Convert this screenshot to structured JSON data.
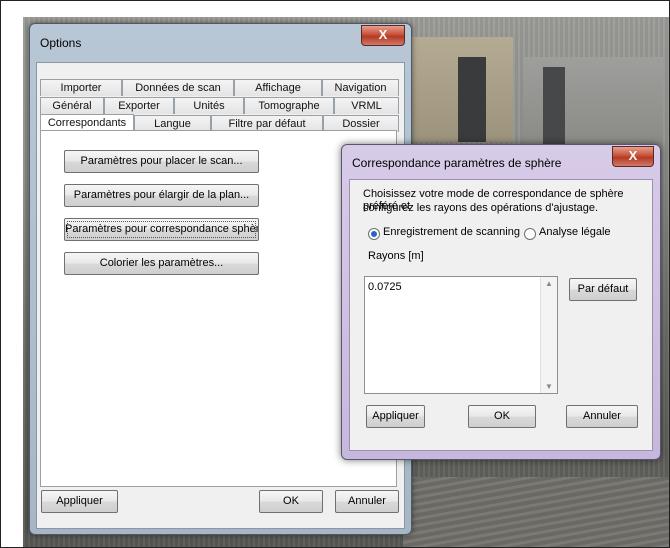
{
  "options": {
    "title": "Options",
    "close": "X",
    "tabs_row1": [
      "Importer",
      "Données de scan",
      "Affichage",
      "Navigation"
    ],
    "tabs_row2": [
      "Général",
      "Exporter",
      "Unités",
      "Tomographe",
      "VRML"
    ],
    "tabs_row3": [
      "Correspondants",
      "Langue",
      "Filtre par défaut",
      "Dossier"
    ],
    "active_tab": "Correspondants",
    "panel_buttons": [
      "Paramètres pour placer le scan...",
      "Paramètres pour élargir de la plan...",
      "Paramètres pour correspondance sphère...",
      "Colorier les paramètres..."
    ],
    "footer": {
      "apply": "Appliquer",
      "ok": "OK",
      "cancel": "Annuler"
    }
  },
  "sphere_dialog": {
    "title": "Correspondance paramètres de sphère",
    "close": "X",
    "description_line1": "Choisissez votre mode de correspondance de sphère préféré et",
    "description_line2": "configurez les rayons des opérations d'ajustage.",
    "radio_scanning": "Enregistrement de scanning",
    "radio_legal": "Analyse légale",
    "radio_selected": "Enregistrement de scanning",
    "radius_label": "Rayons  [m]",
    "radius_value": "0.0725",
    "default_button": "Par défaut",
    "footer": {
      "apply": "Appliquer",
      "ok": "OK",
      "cancel": "Annuler"
    }
  }
}
